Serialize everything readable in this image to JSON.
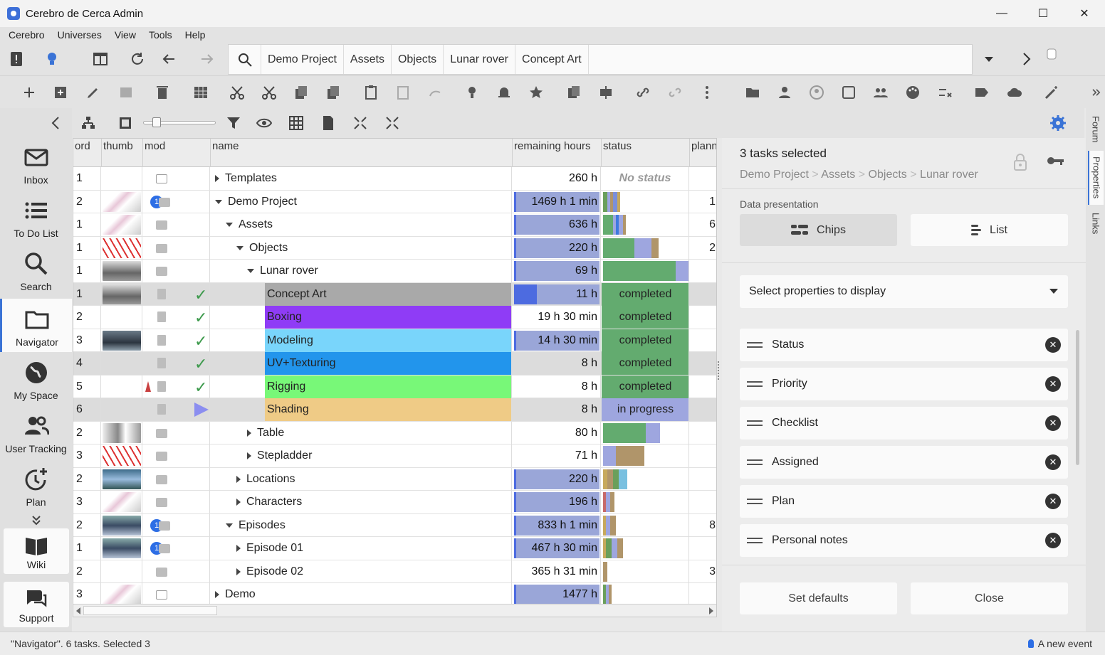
{
  "window": {
    "title": "Cerebro de Cerca  Admin",
    "controls": {
      "minimize": "—",
      "maximize": "☐",
      "close": "✕"
    }
  },
  "menu": [
    "Cerebro",
    "Universes",
    "View",
    "Tools",
    "Help"
  ],
  "breadcrumb": [
    "Demo Project",
    "Assets",
    "Objects",
    "Lunar rover",
    "Concept Art"
  ],
  "left_nav": {
    "items": [
      {
        "label": "Inbox",
        "icon": "envelope-icon"
      },
      {
        "label": "To Do List",
        "icon": "list-icon"
      },
      {
        "label": "Search",
        "icon": "search-icon"
      },
      {
        "label": "Navigator",
        "icon": "folder-icon",
        "active": true
      },
      {
        "label": "My Space",
        "icon": "globe-icon"
      },
      {
        "label": "User Tracking",
        "icon": "users-icon"
      },
      {
        "label": "Plan",
        "icon": "clock-plus-icon"
      }
    ],
    "cards": [
      {
        "label": "Wiki",
        "icon": "book-icon"
      },
      {
        "label": "Support",
        "icon": "chat-icon"
      }
    ]
  },
  "grid": {
    "columns": {
      "ord": "ord",
      "thumb": "thumb",
      "mod": "mod",
      "name": "name",
      "remaining": "remaining hours",
      "status": "status",
      "plan": "plann"
    },
    "rows": [
      {
        "ord": "1",
        "name": "Templates",
        "remaining": "260 h",
        "status": "No status",
        "plan": "",
        "indent": 0,
        "expand": "right",
        "remaining_fraction": 0
      },
      {
        "ord": "2",
        "name": "Demo Project",
        "remaining": "1469 h 1 min",
        "status": "",
        "plan": "1",
        "indent": 0,
        "expand": "down",
        "remaining_fraction": 1
      },
      {
        "ord": "1",
        "name": "Assets",
        "remaining": "636 h",
        "status": "",
        "plan": "6",
        "indent": 1,
        "expand": "down",
        "remaining_fraction": 1
      },
      {
        "ord": "1",
        "name": "Objects",
        "remaining": "220 h",
        "status": "",
        "plan": "2",
        "indent": 2,
        "expand": "down",
        "remaining_fraction": 1
      },
      {
        "ord": "1",
        "name": "Lunar rover",
        "remaining": "69 h",
        "status": "",
        "plan": "",
        "indent": 3,
        "expand": "down",
        "remaining_fraction": 1
      },
      {
        "ord": "1",
        "name": "Concept Art",
        "remaining": "11 h",
        "status": "completed",
        "plan": "",
        "indent": 4,
        "expand": "",
        "remaining_fraction": 1,
        "selected": true
      },
      {
        "ord": "2",
        "name": "Boxing",
        "remaining": "19 h 30 min",
        "status": "completed",
        "plan": "",
        "indent": 4,
        "expand": "",
        "remaining_fraction": 0
      },
      {
        "ord": "3",
        "name": "Modeling",
        "remaining": "14 h 30 min",
        "status": "completed",
        "plan": "",
        "indent": 4,
        "expand": "",
        "remaining_fraction": 1
      },
      {
        "ord": "4",
        "name": "UV+Texturing",
        "remaining": "8 h",
        "status": "completed",
        "plan": "",
        "indent": 4,
        "expand": "",
        "remaining_fraction": 0,
        "selected": true
      },
      {
        "ord": "5",
        "name": "Rigging",
        "remaining": "8 h",
        "status": "completed",
        "plan": "",
        "indent": 4,
        "expand": "",
        "remaining_fraction": 0
      },
      {
        "ord": "6",
        "name": "Shading",
        "remaining": "8 h",
        "status": "in progress",
        "plan": "",
        "indent": 4,
        "expand": "",
        "remaining_fraction": 0,
        "selected": true
      },
      {
        "ord": "2",
        "name": "Table",
        "remaining": "80 h",
        "status": "",
        "plan": "",
        "indent": 3,
        "expand": "right",
        "remaining_fraction": 0
      },
      {
        "ord": "3",
        "name": "Stepladder",
        "remaining": "71 h",
        "status": "",
        "plan": "",
        "indent": 3,
        "expand": "right",
        "remaining_fraction": 0
      },
      {
        "ord": "2",
        "name": "Locations",
        "remaining": "220 h",
        "status": "",
        "plan": "",
        "indent": 2,
        "expand": "right",
        "remaining_fraction": 1
      },
      {
        "ord": "3",
        "name": "Characters",
        "remaining": "196 h",
        "status": "",
        "plan": "",
        "indent": 2,
        "expand": "right",
        "remaining_fraction": 1
      },
      {
        "ord": "2",
        "name": "Episodes",
        "remaining": "833 h 1 min",
        "status": "",
        "plan": "8",
        "indent": 1,
        "expand": "down",
        "remaining_fraction": 1
      },
      {
        "ord": "1",
        "name": "Episode 01",
        "remaining": "467 h 30 min",
        "status": "",
        "plan": "",
        "indent": 2,
        "expand": "right",
        "remaining_fraction": 1
      },
      {
        "ord": "2",
        "name": "Episode 02",
        "remaining": "365 h 31 min",
        "status": "",
        "plan": "3",
        "indent": 2,
        "expand": "right",
        "remaining_fraction": 0
      },
      {
        "ord": "3",
        "name": "Demo",
        "remaining": "1477 h",
        "status": "",
        "plan": "",
        "indent": 0,
        "expand": "right",
        "remaining_fraction": 1
      }
    ]
  },
  "task_colors": {
    "Concept Art": "#a9a9a9",
    "Boxing": "#8f3cf6",
    "Modeling": "#79d5fb",
    "UV+Texturing": "#2295ec",
    "Rigging": "#78f878",
    "Shading": "#efcb86"
  },
  "status_colors": {
    "completed": "#63ab6f",
    "in progress": "#9ea6df",
    "none": "#aaaaaa"
  },
  "panel": {
    "title": "3 tasks selected",
    "path": [
      "Demo Project",
      "Assets",
      "Objects",
      "Lunar rover"
    ],
    "path_sep": ">",
    "data_presentation_label": "Data presentation",
    "chips_label": "Chips",
    "list_label": "List",
    "select_placeholder": "Select properties to display",
    "properties": [
      "Status",
      "Priority",
      "Checklist",
      "Assigned",
      "Plan",
      "Personal notes"
    ],
    "set_defaults": "Set defaults",
    "close": "Close"
  },
  "side_tabs": [
    "Forum",
    "Properties",
    "Links"
  ],
  "statusbar": {
    "text": "\"Navigator\". 6 tasks. Selected 3",
    "event": "A new event"
  },
  "accent_color": "#3a73d6"
}
